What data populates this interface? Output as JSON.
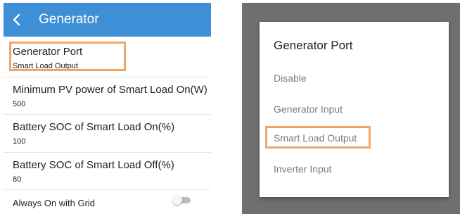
{
  "left": {
    "header": {
      "title": "Generator",
      "back_icon": "chevron-left-icon"
    },
    "settings": [
      {
        "title": "Generator Port",
        "value": "Smart Load Output"
      },
      {
        "title": "Minimum PV power of Smart Load On(W)",
        "value": "500"
      },
      {
        "title": "Battery SOC of Smart Load On(%)",
        "value": "100"
      },
      {
        "title": "Battery SOC of Smart Load Off(%)",
        "value": "80"
      }
    ],
    "toggle_row": {
      "title": "Always On with Grid",
      "state": "off"
    }
  },
  "dialog": {
    "title": "Generator Port",
    "options": [
      "Disable",
      "Generator Input",
      "Smart Load Output",
      "Inverter Input"
    ],
    "highlighted": "Smart Load Output"
  },
  "colors": {
    "header_blue": "#3f8fd6",
    "highlight_orange": "#f0a766",
    "overlay_gray": "#6f6f6f"
  }
}
